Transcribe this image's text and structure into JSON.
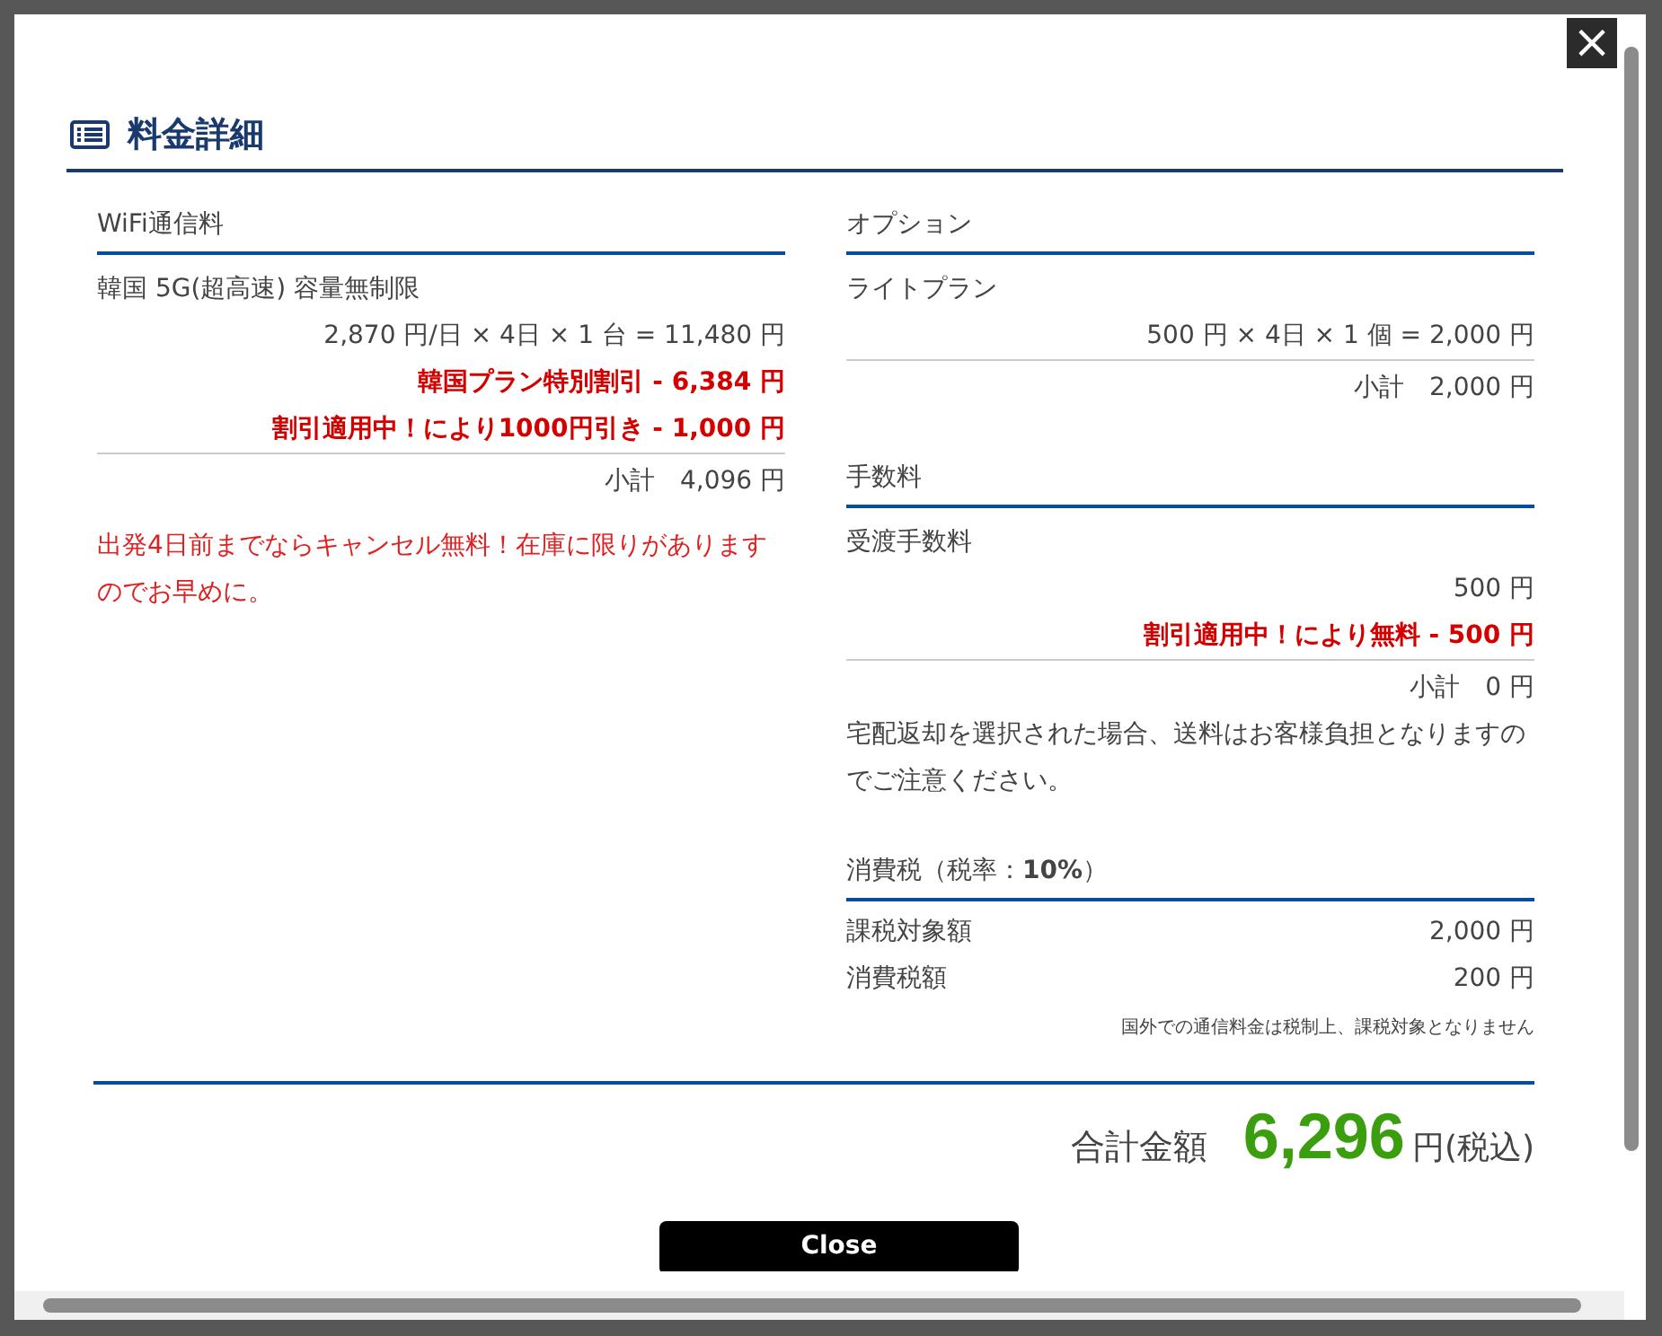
{
  "close_icon": "×",
  "title": "料金詳細",
  "columns": [
    [
      {
        "heading": "WiFi通信料",
        "rows": [
          {
            "kind": "item",
            "text": "韓国 5G(超高速) 容量無制限"
          },
          {
            "kind": "calc",
            "text": "2,870 円/日 × 4日 × 1 台 = 11,480 円"
          },
          {
            "kind": "discount",
            "text": "韓国プラン特別割引 - 6,384 円"
          },
          {
            "kind": "discount",
            "text": "割引適用中！により1000円引き - 1,000 円"
          },
          {
            "kind": "subtotal",
            "label": "小計",
            "value": "4,096 円"
          },
          {
            "kind": "warning",
            "text": "出発4日前までならキャンセル無料！在庫に限りがありますのでお早めに。"
          }
        ]
      }
    ],
    [
      {
        "heading": "オプション",
        "rows": [
          {
            "kind": "item",
            "text": "ライトプラン"
          },
          {
            "kind": "calc",
            "text": "500 円 × 4日 × 1 個 = 2,000 円"
          },
          {
            "kind": "subtotal",
            "label": "小計",
            "value": "2,000 円"
          }
        ]
      },
      {
        "heading": "手数料",
        "rows": [
          {
            "kind": "item",
            "text": "受渡手数料"
          },
          {
            "kind": "calc",
            "text": "500 円"
          },
          {
            "kind": "discount",
            "text": "割引適用中！により無料 - 500 円"
          },
          {
            "kind": "subtotal",
            "label": "小計",
            "value": "0 円"
          },
          {
            "kind": "note",
            "text": "宅配返却を選択された場合、送料はお客様負担となりますのでご注意ください。"
          }
        ]
      },
      {
        "heading": "消費税（税率：**10%**）",
        "rows": [
          {
            "kind": "pair",
            "label": "課税対象額",
            "value": "2,000 円"
          },
          {
            "kind": "pair",
            "label": "消費税額",
            "value": "200 円"
          },
          {
            "kind": "small",
            "text": "国外での通信料金は税制上、課税対象となりません"
          }
        ]
      }
    ]
  ],
  "total": {
    "label": "合計金額",
    "amount": "6,296",
    "unit": "円(税込)"
  },
  "button": "Close"
}
